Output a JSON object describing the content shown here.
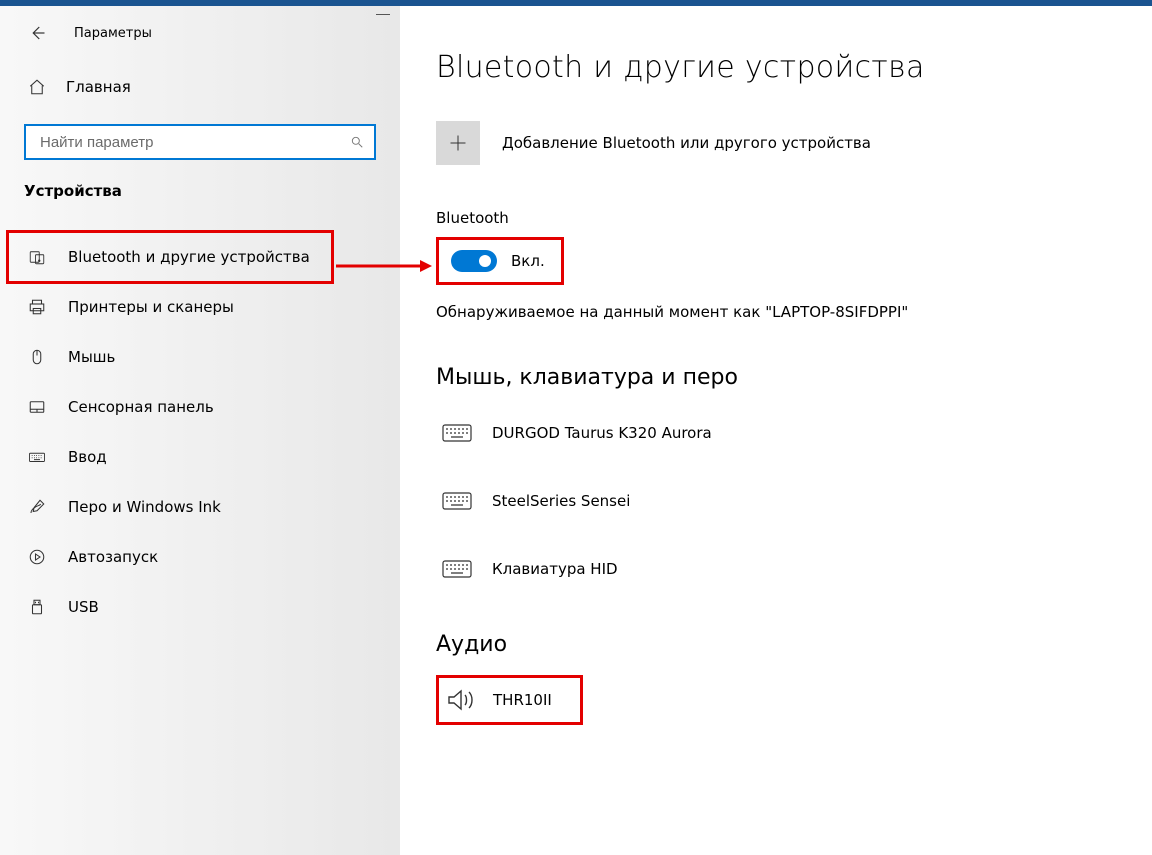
{
  "header": {
    "app_title": "Параметры"
  },
  "sidebar": {
    "home_label": "Главная",
    "search_placeholder": "Найти параметр",
    "category_label": "Устройства",
    "items": [
      {
        "icon": "bluetooth",
        "label": "Bluetooth и другие устройства"
      },
      {
        "icon": "printer",
        "label": "Принтеры и сканеры"
      },
      {
        "icon": "mouse",
        "label": "Мышь"
      },
      {
        "icon": "touchpad",
        "label": "Сенсорная панель"
      },
      {
        "icon": "keyboard",
        "label": "Ввод"
      },
      {
        "icon": "pen",
        "label": "Перо и Windows Ink"
      },
      {
        "icon": "autoplay",
        "label": "Автозапуск"
      },
      {
        "icon": "usb",
        "label": "USB"
      }
    ]
  },
  "main": {
    "title": "Bluetooth и другие устройства",
    "add_device_label": "Добавление Bluetooth или другого устройства",
    "bluetooth_label": "Bluetooth",
    "bluetooth_state": "Вкл.",
    "discoverable_text": "Обнаруживаемое на данный момент как \"LAPTOP-8SIFDPPI\"",
    "sections": {
      "input_devices": {
        "title": "Мышь, клавиатура и перо",
        "items": [
          {
            "name": "DURGOD Taurus K320 Aurora",
            "icon": "keyboard"
          },
          {
            "name": "SteelSeries Sensei",
            "icon": "keyboard"
          },
          {
            "name": "Клавиатура HID",
            "icon": "keyboard"
          }
        ]
      },
      "audio": {
        "title": "Аудио",
        "items": [
          {
            "name": "THR10II",
            "icon": "speaker"
          }
        ]
      }
    }
  }
}
